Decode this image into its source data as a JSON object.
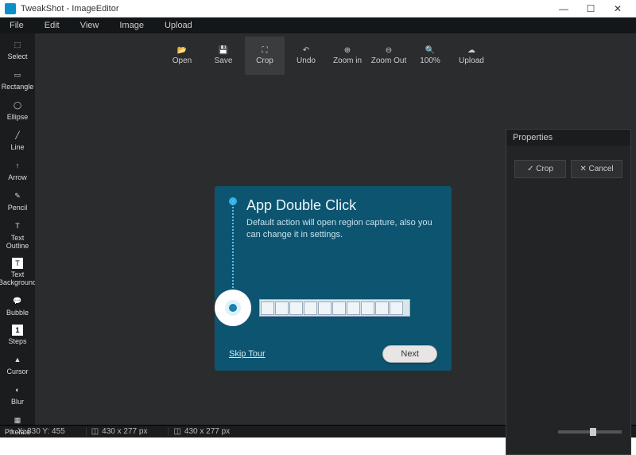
{
  "window": {
    "title": "TweakShot - ImageEditor"
  },
  "menu": [
    "File",
    "Edit",
    "View",
    "Image",
    "Upload"
  ],
  "toolbar": {
    "open": "Open",
    "save": "Save",
    "crop": "Crop",
    "undo": "Undo",
    "zoomin": "Zoom in",
    "zoomout": "Zoom Out",
    "zoom100": "100%",
    "upload": "Upload"
  },
  "tools": {
    "select": "Select",
    "rectangle": "Rectangle",
    "ellipse": "Ellipse",
    "line": "Line",
    "arrow": "Arrow",
    "pencil": "Pencil",
    "textoutline": "Text\nOutline",
    "textbg": "Text\nBackground",
    "bubble": "Bubble",
    "steps": "Steps",
    "cursor": "Cursor",
    "blur": "Blur",
    "pixelate": "Pixelate"
  },
  "properties": {
    "title": "Properties",
    "crop": "✓ Crop",
    "cancel": "✕ Cancel"
  },
  "tour": {
    "title": "App Double Click",
    "body": "Default action will open region capture, also you can change it in settings.",
    "skip": "Skip Tour",
    "next": "Next"
  },
  "status": {
    "coords": "X: 830 Y: 455",
    "dim1": "430 x 277 px",
    "dim2": "430 x 277 px",
    "zoom": "100%"
  }
}
